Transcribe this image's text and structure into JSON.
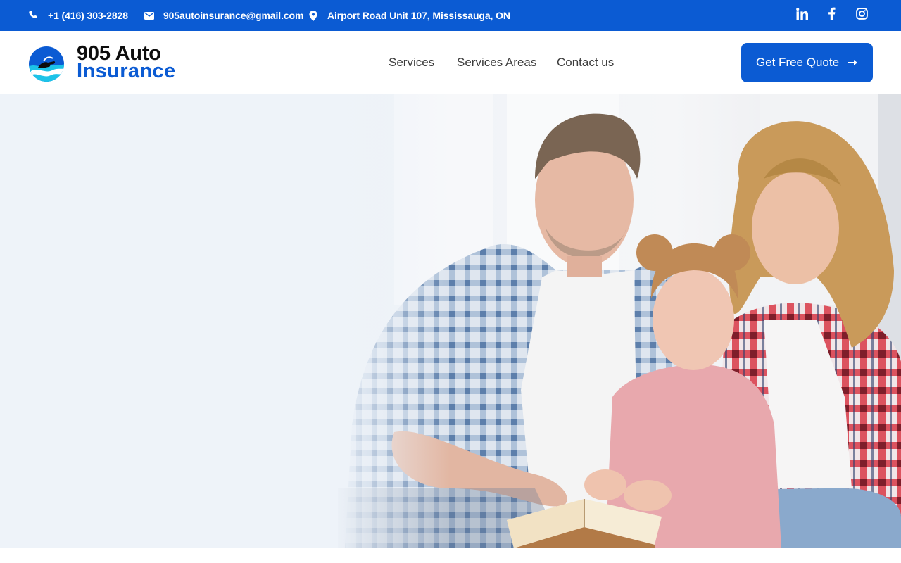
{
  "topbar": {
    "phone": "+1 (416) 303-2828",
    "email": "905autoinsurance@gmail.com",
    "address": "Airport Road Unit 107, Mississauga, ON",
    "icons": {
      "phone": "phone-icon",
      "email": "envelope-icon",
      "address": "map-pin-icon"
    },
    "social": [
      "linkedin-icon",
      "facebook-icon",
      "instagram-icon"
    ]
  },
  "logo": {
    "line1": "905 Auto",
    "line2": "Insurance"
  },
  "nav": {
    "services": "Services",
    "areas": "Services Areas",
    "contact": "Contact us"
  },
  "cta": {
    "label": "Get Free Quote",
    "icon": "arrow-right-icon"
  },
  "colors": {
    "brand_blue": "#0b5bd3",
    "hero_bg": "#eef3f9",
    "logo_cyan": "#1cc3e8",
    "nav_text": "#3c3c3c"
  },
  "hero": {
    "image": "family-photo (father, daughter, mother with book)"
  }
}
